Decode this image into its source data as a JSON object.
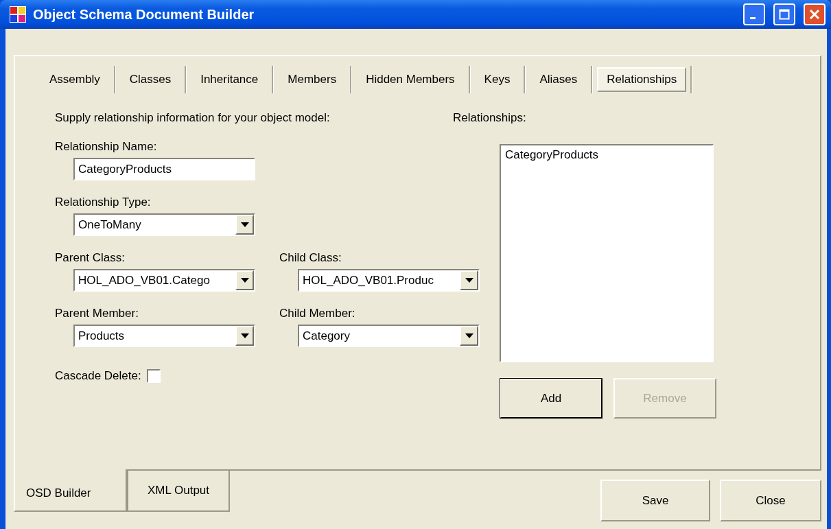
{
  "window": {
    "title": "Object Schema Document Builder"
  },
  "tabs": [
    {
      "label": "Assembly",
      "selected": false
    },
    {
      "label": "Classes",
      "selected": false
    },
    {
      "label": "Inheritance",
      "selected": false
    },
    {
      "label": "Members",
      "selected": false
    },
    {
      "label": "Hidden Members",
      "selected": false
    },
    {
      "label": "Keys",
      "selected": false
    },
    {
      "label": "Aliases",
      "selected": false
    },
    {
      "label": "Relationships",
      "selected": true
    }
  ],
  "form": {
    "instructions": "Supply relationship information for your object model:",
    "relationship_name": {
      "label": "Relationship Name:",
      "value": "CategoryProducts"
    },
    "relationship_type": {
      "label": "Relationship Type:",
      "value": "OneToMany"
    },
    "parent_class": {
      "label": "Parent Class:",
      "value": "HOL_ADO_VB01.Catego"
    },
    "child_class": {
      "label": "Child Class:",
      "value": "HOL_ADO_VB01.Produc"
    },
    "parent_member": {
      "label": "Parent Member:",
      "value": "Products"
    },
    "child_member": {
      "label": "Child Member:",
      "value": "Category"
    },
    "cascade_delete": {
      "label": "Cascade Delete:",
      "checked": false
    }
  },
  "relationships": {
    "label": "Relationships:",
    "items": [
      "CategoryProducts"
    ],
    "buttons": [
      {
        "label": "Add",
        "disabled": false,
        "default": true
      },
      {
        "label": "Remove",
        "disabled": true,
        "default": false
      }
    ]
  },
  "bottom_tabs": [
    {
      "label": "OSD Builder",
      "selected": true
    },
    {
      "label": "XML Output",
      "selected": false
    }
  ],
  "buttons": [
    {
      "label": "Save"
    },
    {
      "label": "Close"
    }
  ]
}
